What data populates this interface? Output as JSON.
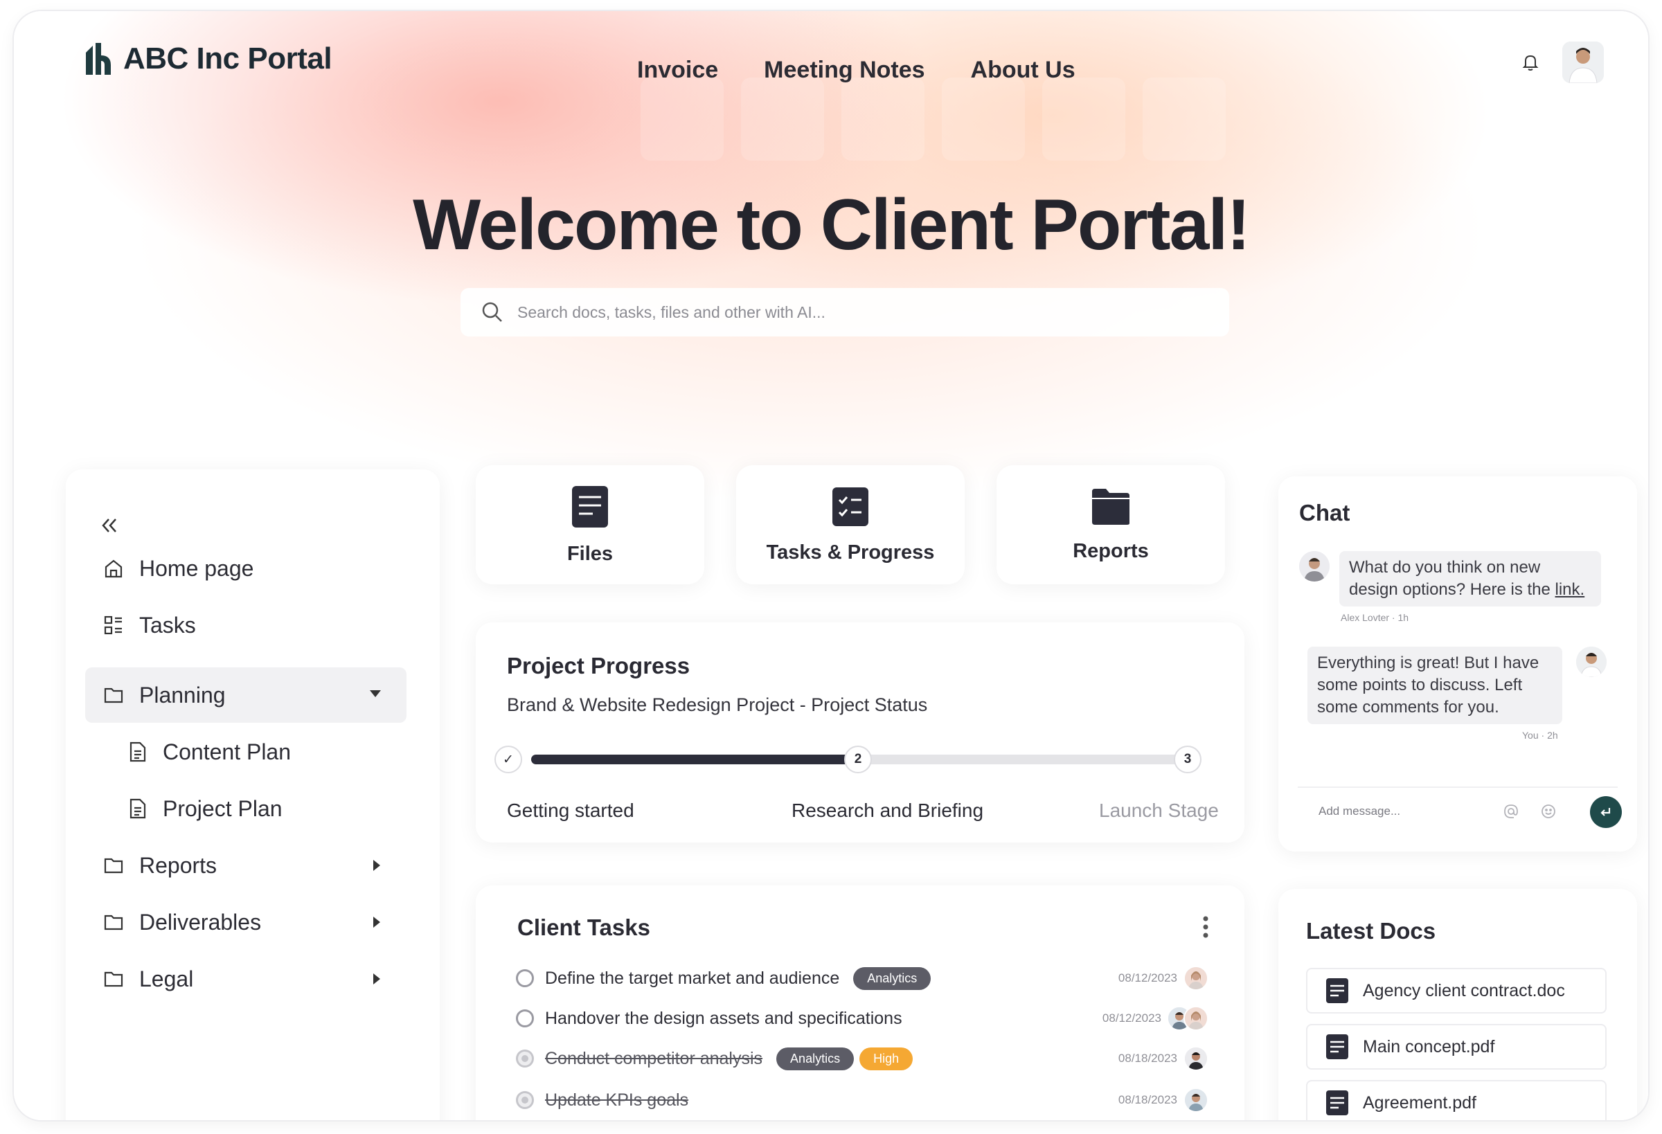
{
  "brand": {
    "name": "ABC Inc Portal"
  },
  "nav": {
    "items": [
      "Invoice",
      "Meeting Notes",
      "About Us"
    ]
  },
  "hero": {
    "title": "Welcome to Client Portal!"
  },
  "search": {
    "placeholder": "Search docs, tasks, files and other with AI..."
  },
  "sidebar": {
    "items": [
      {
        "label": "Home page",
        "icon": "home-icon"
      },
      {
        "label": "Tasks",
        "icon": "tasks-icon"
      },
      {
        "label": "Planning",
        "icon": "folder-icon",
        "expanded": true
      },
      {
        "label": "Content Plan",
        "icon": "document-icon"
      },
      {
        "label": "Project Plan",
        "icon": "document-icon"
      },
      {
        "label": "Reports",
        "icon": "folder-icon"
      },
      {
        "label": "Deliverables",
        "icon": "folder-icon"
      },
      {
        "label": "Legal",
        "icon": "folder-icon"
      }
    ]
  },
  "quick_actions": [
    {
      "label": "Files",
      "icon": "files-icon"
    },
    {
      "label": "Tasks & Progress",
      "icon": "checklist-icon"
    },
    {
      "label": "Reports",
      "icon": "reports-folder-icon"
    }
  ],
  "progress": {
    "title": "Project Progress",
    "subtitle": "Brand & Website Redesign Project - Project Status",
    "completion": 0.5,
    "steps": [
      {
        "label": "Getting started",
        "marker": "✓",
        "state": "done"
      },
      {
        "label": "Research and Briefing",
        "marker": "2",
        "state": "current"
      },
      {
        "label": "Launch Stage",
        "marker": "3",
        "state": "upcoming"
      }
    ]
  },
  "tasks": {
    "title": "Client Tasks",
    "rows": [
      {
        "text": "Define the target market and audience",
        "badges": [
          "Analytics"
        ],
        "date": "08/12/2023",
        "done": false
      },
      {
        "text": "Handover the design assets and specifications",
        "badges": [],
        "date": "08/12/2023",
        "done": false
      },
      {
        "text": "Conduct competitor analysis",
        "badges": [
          "Analytics",
          "High"
        ],
        "date": "08/18/2023",
        "done": true
      },
      {
        "text": "Update KPIs goals",
        "badges": [],
        "date": "08/18/2023",
        "done": true
      }
    ]
  },
  "chat": {
    "title": "Chat",
    "messages": [
      {
        "text_before_link": "What do you think on new design options? Here is the ",
        "link": "link.",
        "meta": "Alex Lovter · 1h"
      },
      {
        "text": "Everything is great! But I have some points to discuss. Left some comments for you.",
        "meta": "You · 2h"
      }
    ],
    "composer_placeholder": "Add message...",
    "send_color": "#1f4a4a"
  },
  "docs": {
    "title": "Latest Docs",
    "items": [
      "Agency client contract.doc",
      "Main concept.pdf",
      "Agreement.pdf"
    ]
  },
  "colors": {
    "accent_dark": "#2c2d3a",
    "badge_high": "#f5a833",
    "badge_analytics": "#5c5c66"
  }
}
